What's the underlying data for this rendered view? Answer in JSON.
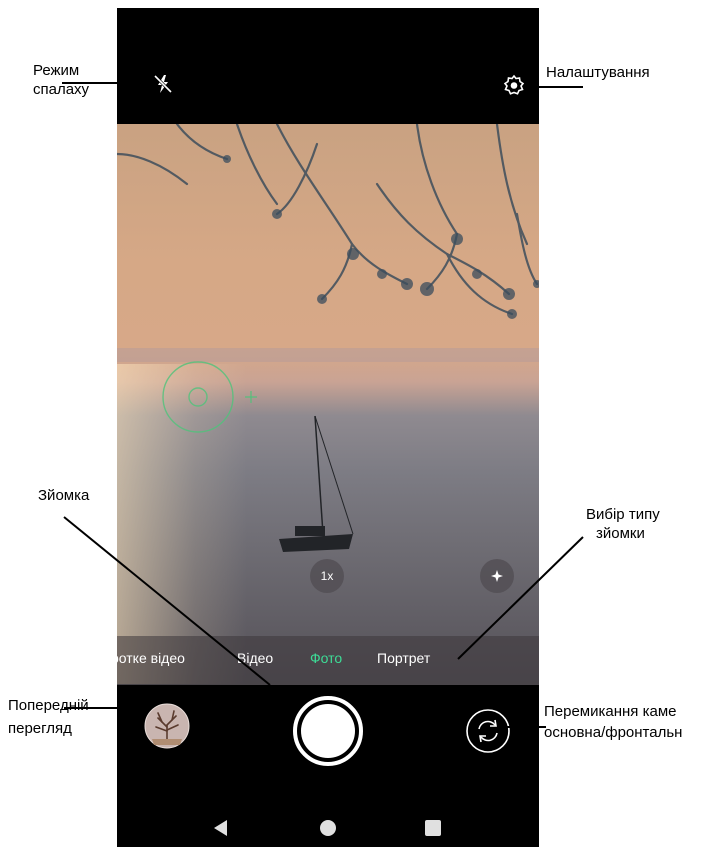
{
  "annotations": {
    "flash": [
      "Режим",
      "спалаху"
    ],
    "settings": "Налаштування",
    "shoot": "Зйомка",
    "mode_select": [
      "Вибір типу",
      "зйомки"
    ],
    "preview": [
      "Попередній",
      "перегляд"
    ],
    "switch_camera": [
      "Перемикання каме",
      "основна/фронтальн"
    ]
  },
  "camera": {
    "zoom_label": "1x",
    "modes": [
      "ротке відео",
      "Відео",
      "Фото",
      "Портрет"
    ],
    "active_mode_index": 2
  },
  "colors": {
    "active_mode": "#3ddc97",
    "focus_ring": "#4fc37a"
  },
  "icons": {
    "flash": "flash-off-icon",
    "settings": "settings-gear-icon",
    "beauty": "sparkle-icon",
    "switch_camera": "switch-camera-icon",
    "back": "nav-back-triangle",
    "home": "nav-home-circle",
    "recents": "nav-recents-square"
  }
}
